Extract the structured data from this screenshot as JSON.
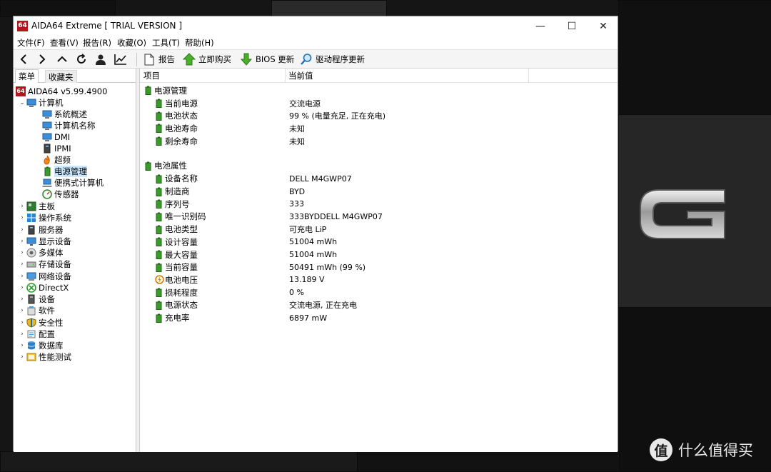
{
  "window": {
    "title": "AIDA64 Extreme  [ TRIAL VERSION ]",
    "app_icon_text": "64",
    "min_glyph": "—",
    "max_glyph": "☐",
    "close_glyph": "✕"
  },
  "menu": [
    "文件(F)",
    "查看(V)",
    "报告(R)",
    "收藏(O)",
    "工具(T)",
    "帮助(H)"
  ],
  "toolbar": {
    "report": "报告",
    "buy": "立即购买",
    "bios": "BIOS 更新",
    "driver": "驱动程序更新"
  },
  "left_tabs": [
    "菜单",
    "收藏夹"
  ],
  "tree": {
    "root": "AIDA64 v5.99.4900",
    "computer": "计算机",
    "computer_children": [
      "系统概述",
      "计算机名称",
      "DMI",
      "IPMI",
      "超频",
      "电源管理",
      "便携式计算机",
      "传感器"
    ],
    "categories": [
      "主板",
      "操作系统",
      "服务器",
      "显示设备",
      "多媒体",
      "存储设备",
      "网络设备",
      "DirectX",
      "设备",
      "软件",
      "安全性",
      "配置",
      "数据库",
      "性能测试"
    ],
    "selected": "电源管理"
  },
  "columns": [
    "项目",
    "当前值"
  ],
  "sections": [
    {
      "title": "电源管理",
      "rows": [
        {
          "label": "当前电源",
          "value": "交流电源"
        },
        {
          "label": "电池状态",
          "value": "99 % (电量充足, 正在充电)"
        },
        {
          "label": "电池寿命",
          "value": "未知"
        },
        {
          "label": "剩余寿命",
          "value": "未知"
        }
      ]
    },
    {
      "title": "电池属性",
      "rows": [
        {
          "label": "设备名称",
          "value": "DELL M4GWP07"
        },
        {
          "label": "制造商",
          "value": "BYD"
        },
        {
          "label": "序列号",
          "value": "333"
        },
        {
          "label": "唯一识别码",
          "value": "333BYDDELL M4GWP07"
        },
        {
          "label": "电池类型",
          "value": "可充电 LiP"
        },
        {
          "label": "设计容量",
          "value": "51004 mWh"
        },
        {
          "label": "最大容量",
          "value": "51004 mWh"
        },
        {
          "label": "当前容量",
          "value": "50491 mWh  (99 %)"
        },
        {
          "label": "电池电压",
          "value": "13.189 V"
        },
        {
          "label": "损耗程度",
          "value": "0 %"
        },
        {
          "label": "电源状态",
          "value": "交流电源, 正在充电"
        },
        {
          "label": "充电率",
          "value": "6897 mW"
        }
      ]
    }
  ],
  "watermark": {
    "icon": "值",
    "text": "什么值得买"
  },
  "colors": {
    "accent": "#b3161c",
    "selection": "#cce8ff",
    "battery_green": "#3a9a2a"
  }
}
